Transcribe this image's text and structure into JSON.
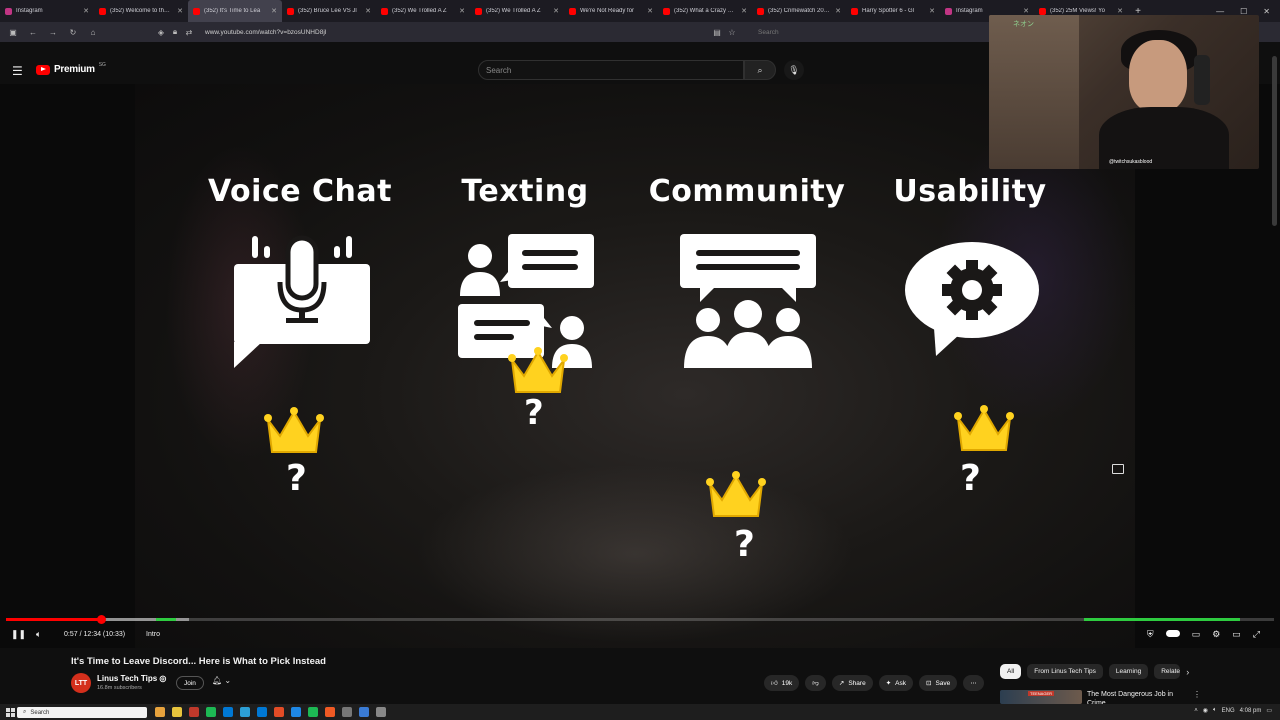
{
  "browser": {
    "tabs": [
      {
        "title": "Instagram",
        "color": "#c13584",
        "active": false
      },
      {
        "title": "(352) Welcome to the m",
        "color": "#ff0000",
        "active": false
      },
      {
        "title": "(352) It's Time to Lea",
        "color": "#ff0000",
        "active": true
      },
      {
        "title": "(352) Bruce Lee VS Jl",
        "color": "#ff0000",
        "active": false
      },
      {
        "title": "(352) We Trolled A Z",
        "color": "#ff0000",
        "active": false
      },
      {
        "title": "(352) We Trolled A Z",
        "color": "#ff0000",
        "active": false
      },
      {
        "title": "We're Not Ready for",
        "color": "#ff0000",
        "active": false
      },
      {
        "title": "(352) What a Crazy Story",
        "color": "#ff0000",
        "active": false
      },
      {
        "title": "(352) Crimewatch 2026 |",
        "color": "#ff0000",
        "active": false
      },
      {
        "title": "Harry Spotter 6 - Gl",
        "color": "#ff0000",
        "active": false
      },
      {
        "title": "Instagram",
        "color": "#c13584",
        "active": false
      },
      {
        "title": "(352) 25M Views! Yo",
        "color": "#ff0000",
        "active": false
      }
    ],
    "url": "www.youtube.com/watch?v=bzosUNHD8jI",
    "search_placeholder": "Search"
  },
  "youtube": {
    "logo_text": "Premium",
    "logo_country": "SG",
    "search_placeholder": "Search"
  },
  "video": {
    "categories": [
      {
        "label": "Voice Chat",
        "icon": "microphone-chat-icon"
      },
      {
        "label": "Texting",
        "icon": "texting-chat-icon"
      },
      {
        "label": "Community",
        "icon": "community-icon"
      },
      {
        "label": "Usability",
        "icon": "settings-chat-icon"
      }
    ],
    "crown_color": "#ffd21f",
    "webcam_handle": "@twitchsukasblood",
    "webcam_neon": "ネオン"
  },
  "player": {
    "time": "0:57 / 12:34 (10:33)",
    "chapter": "Intro",
    "progress_fraction": 0.075
  },
  "below": {
    "title": "It's Time to Leave Discord... Here is What to Pick Instead",
    "channel": "Linus Tech Tips ◎",
    "channel_initials": "LTT",
    "subscribers": "16.8m subscribers",
    "join": "Join",
    "likes": "19k",
    "share": "Share",
    "ask": "Ask",
    "save": "Save",
    "chips": [
      "All",
      "From Linus Tech Tips",
      "Learning",
      "Related"
    ],
    "rec_title": "The Most Dangerous Job in Crime",
    "rec_badge": "TEENAGER"
  },
  "taskbar": {
    "search": "Search",
    "lang": "ENG",
    "time": "4:08 pm"
  }
}
